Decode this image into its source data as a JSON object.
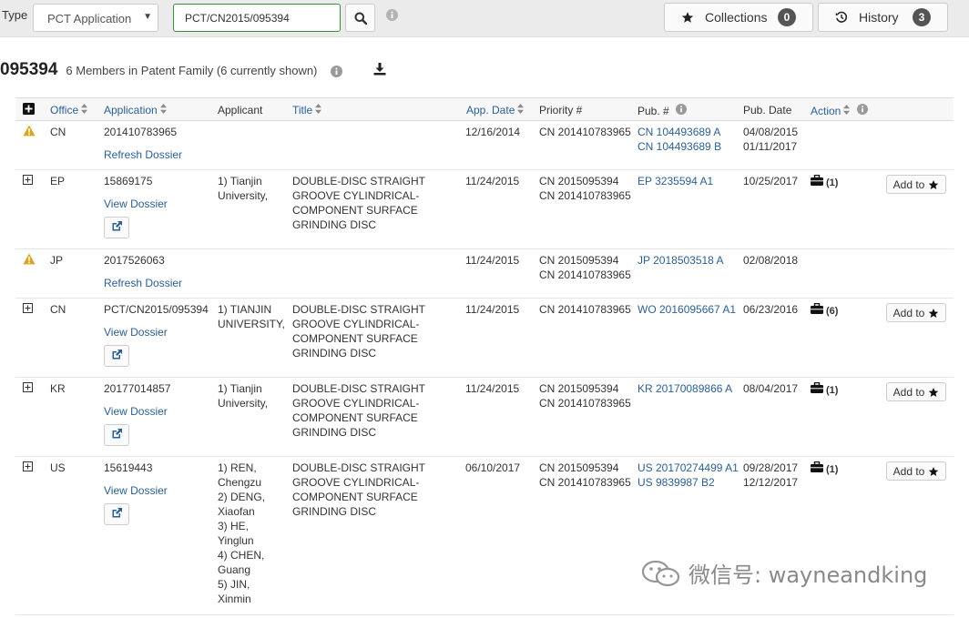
{
  "search": {
    "type_label": "Type",
    "type_value": "PCT Application",
    "query_value": "PCT/CN2015/095394"
  },
  "toolbar": {
    "collections_label": "Collections",
    "collections_count": "0",
    "history_label": "History",
    "history_count": "3"
  },
  "heading": {
    "number": "095394",
    "subtitle": "6 Members in Patent Family (6 currently shown)"
  },
  "table": {
    "headers": {
      "office": "Office",
      "application": "Application",
      "applicant": "Applicant",
      "title": "Title",
      "app_date": "App. Date",
      "priority": "Priority #",
      "pub_no": "Pub. #",
      "pub_date": "Pub. Date",
      "action": "Action"
    },
    "rows": [
      {
        "status": "warning",
        "office": "CN",
        "application": "201410783965",
        "dossier_link": "Refresh Dossier",
        "applicant": [],
        "title": "",
        "app_date": "12/16/2014",
        "priority": [
          "CN 201410783965"
        ],
        "pub_numbers": [
          "CN 104493689 A",
          "CN 104493689 B"
        ],
        "pub_dates": [
          "04/08/2015",
          "01/11/2017"
        ],
        "action_count": "",
        "add_to_label": ""
      },
      {
        "status": "expand",
        "office": "EP",
        "application": "15869175",
        "dossier_link": "View Dossier",
        "applicant": [
          "1) Tianjin",
          "University,"
        ],
        "title": "DOUBLE-DISC STRAIGHT GROOVE CYLINDRICAL-COMPONENT SURFACE GRINDING DISC",
        "app_date": "11/24/2015",
        "priority": [
          "CN 2015095394",
          "CN 201410783965"
        ],
        "pub_numbers": [
          "EP 3235594 A1"
        ],
        "pub_dates": [
          "10/25/2017"
        ],
        "action_count": "(1)",
        "add_to_label": "Add to"
      },
      {
        "status": "warning",
        "office": "JP",
        "application": "2017526063",
        "dossier_link": "Refresh Dossier",
        "applicant": [],
        "title": "",
        "app_date": "11/24/2015",
        "priority": [
          "CN 2015095394",
          "CN 201410783965"
        ],
        "pub_numbers": [
          "JP 2018503518 A"
        ],
        "pub_dates": [
          "02/08/2018"
        ],
        "action_count": "",
        "add_to_label": ""
      },
      {
        "status": "expand",
        "office": "CN",
        "application": "PCT/CN2015/095394",
        "dossier_link": "View Dossier",
        "applicant": [
          "1) TIANJIN",
          "UNIVERSITY,"
        ],
        "title": "DOUBLE-DISC STRAIGHT GROOVE CYLINDRICAL-COMPONENT SURFACE GRINDING DISC",
        "app_date": "11/24/2015",
        "priority": [
          "CN 201410783965"
        ],
        "pub_numbers": [
          "WO 2016095667 A1"
        ],
        "pub_dates": [
          "06/23/2016"
        ],
        "action_count": "(6)",
        "add_to_label": "Add to"
      },
      {
        "status": "expand",
        "office": "KR",
        "application": "20177014857",
        "dossier_link": "View Dossier",
        "applicant": [
          "1) Tianjin",
          "University,"
        ],
        "title": "DOUBLE-DISC STRAIGHT GROOVE CYLINDRICAL-COMPONENT SURFACE GRINDING DISC",
        "app_date": "11/24/2015",
        "priority": [
          "CN 2015095394",
          "CN 201410783965"
        ],
        "pub_numbers": [
          "KR 20170089866 A"
        ],
        "pub_dates": [
          "08/04/2017"
        ],
        "action_count": "(1)",
        "add_to_label": "Add to"
      },
      {
        "status": "expand",
        "office": "US",
        "application": "15619443",
        "dossier_link": "View Dossier",
        "applicant": [
          "1) REN,",
          "Chengzu",
          "2) DENG,",
          "Xiaofan",
          "3) HE,",
          "Yinglun",
          "4) CHEN,",
          "Guang",
          "5) JIN,",
          "Xinmin"
        ],
        "title": "DOUBLE-DISC STRAIGHT GROOVE CYLINDRICAL-COMPONENT SURFACE GRINDING DISC",
        "app_date": "06/10/2017",
        "priority": [
          "CN 2015095394",
          "CN 201410783965"
        ],
        "pub_numbers": [
          "US 20170274499 A1",
          "US 9839987 B2"
        ],
        "pub_dates": [
          "09/28/2017",
          "12/12/2017"
        ],
        "action_count": "(1)",
        "add_to_label": "Add to"
      }
    ]
  },
  "watermark": {
    "text": "微信号: wayneandking"
  },
  "icons": {
    "warning": "warning-triangle-icon",
    "expand": "plus-square-icon",
    "search": "search-icon",
    "info": "info-circle-icon",
    "star": "star-icon",
    "history": "history-icon",
    "download": "download-icon",
    "external": "external-link-icon",
    "briefcase": "briefcase-icon"
  },
  "colors": {
    "link": "#2a5f95",
    "warning": "#d9a521",
    "badge": "#555555",
    "input_focus": "#3c8c3c"
  }
}
